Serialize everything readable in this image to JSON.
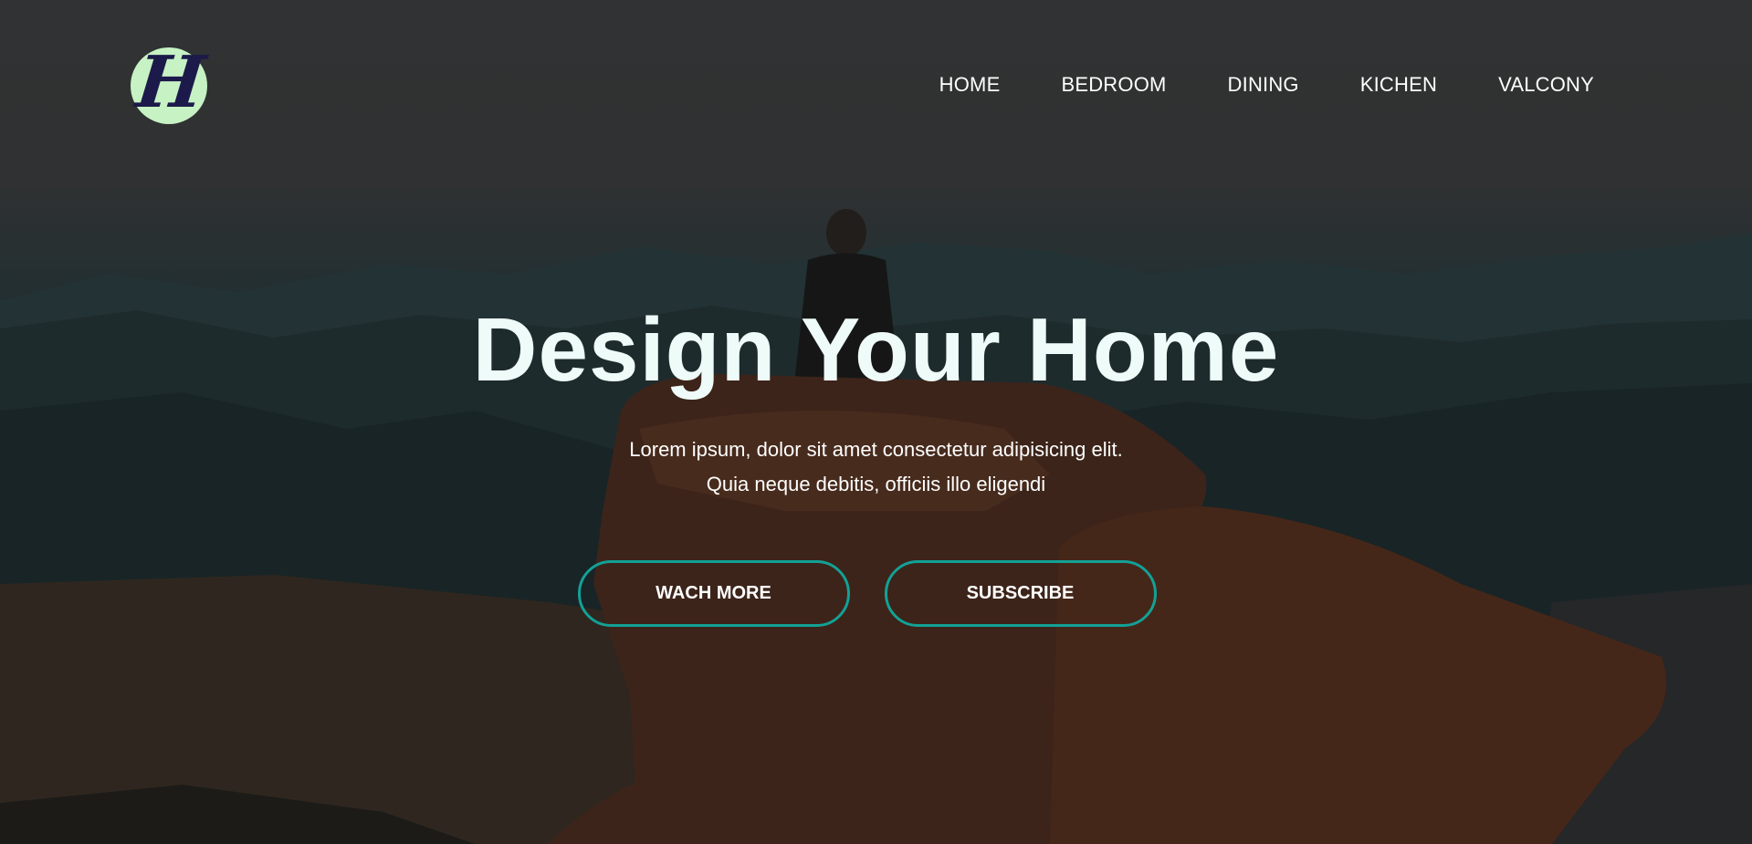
{
  "logo": {
    "letter": "H"
  },
  "nav": {
    "items": [
      {
        "label": "HOME"
      },
      {
        "label": "BEDROOM"
      },
      {
        "label": "DINING"
      },
      {
        "label": "KICHEN"
      },
      {
        "label": "VALCONY"
      }
    ]
  },
  "hero": {
    "headline": "Design Your Home",
    "subtitle_line1": "Lorem ipsum, dolor sit amet consectetur adipisicing elit.",
    "subtitle_line2": "Quia neque debitis, officiis illo eligendi",
    "watch_more_label": "WACH MORE",
    "subscribe_label": "SUBSCRIBE"
  },
  "colors": {
    "logo_background": "#c7f2c4",
    "logo_letter": "#1c1a4a",
    "button_border": "#13a196",
    "headline": "#eefbf8"
  }
}
